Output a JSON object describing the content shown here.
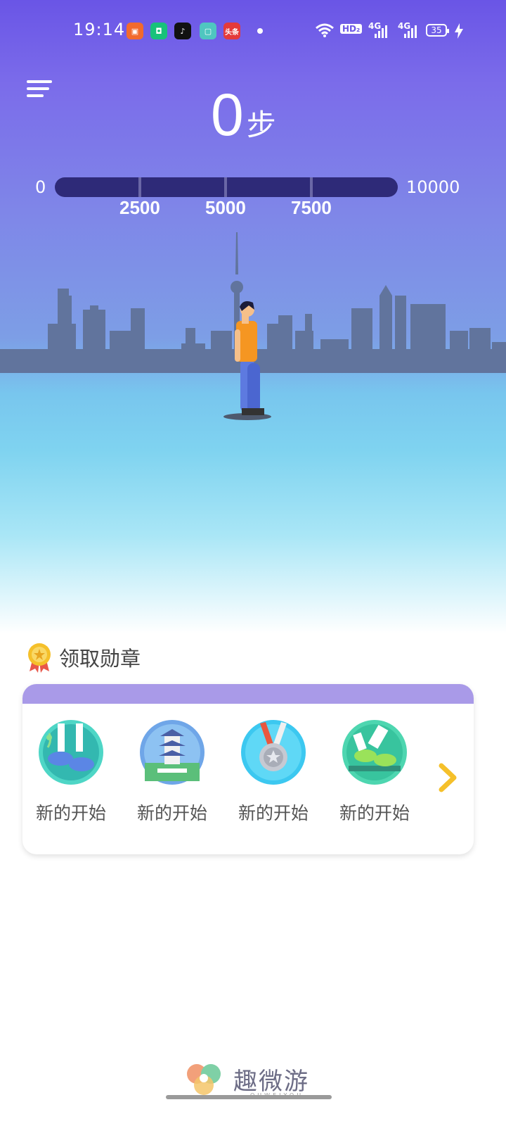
{
  "status_bar": {
    "time": "19:14",
    "apps": [
      "store-icon",
      "delivery-icon",
      "tiktok-icon",
      "gallery-icon",
      "toutiao-icon"
    ],
    "toutiao_label": "头条",
    "network_hd": "HD₂",
    "network_4g_a": "4G",
    "network_4g_b": "4G",
    "battery": "35"
  },
  "header": {
    "menu_icon": "menu-icon",
    "steps": "0",
    "unit": "步"
  },
  "progress": {
    "min": "0",
    "max": "10000",
    "ticks": [
      "2500",
      "5000",
      "7500"
    ],
    "value": 0,
    "fill_color": "#f5b623",
    "track_color": "#2e2a78"
  },
  "medals": {
    "title": "领取勋章",
    "items": [
      {
        "label": "新的开始",
        "icon": "feet-shoes-icon"
      },
      {
        "label": "新的开始",
        "icon": "pagoda-icon"
      },
      {
        "label": "新的开始",
        "icon": "silver-medal-icon"
      },
      {
        "label": "新的开始",
        "icon": "running-shoes-icon"
      }
    ],
    "next_icon": "chevron-right-icon"
  },
  "footer": {
    "brand": "趣微游",
    "sub": "QUWEIYOU"
  },
  "colors": {
    "primary": "#6a55e6",
    "card_header": "#a99ae8",
    "accent": "#f5c02a"
  }
}
